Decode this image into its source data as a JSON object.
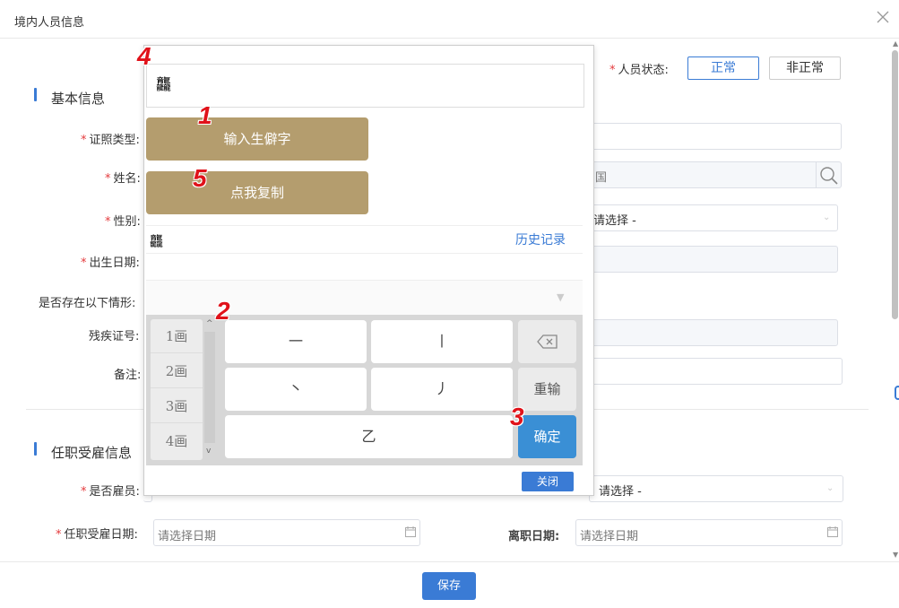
{
  "dialog": {
    "title": "境内人员信息",
    "close_icon": "close-icon"
  },
  "status": {
    "label": "人员状态:",
    "normal": "正常",
    "abnormal": "非正常"
  },
  "basic": {
    "section_title": "基本信息",
    "id_type": "证照类型:",
    "name": "姓名:",
    "gender": "性别:",
    "birth": "出生日期:",
    "situation": "是否存在以下情形:",
    "disability": "残疾证号:",
    "remark": "备注:",
    "country_value": "国",
    "select_placeholder": "请选择 -"
  },
  "employment": {
    "section_title": "任职受雇信息",
    "is_employee": "是否雇员:",
    "hire_date": "任职受雇日期:",
    "hire_date_placeholder": "请选择日期",
    "leave_date": "离职日期:",
    "leave_date_placeholder": "请选择日期",
    "select_placeholder": "请选择 -"
  },
  "save_label": "保存",
  "popup": {
    "input_value": "龘",
    "btn_input_rare": "输入生僻字",
    "btn_copy": "点我复制",
    "candidate": "龘",
    "history_link": "历史记录",
    "strokes": [
      "1画",
      "2画",
      "3画",
      "4画"
    ],
    "keys": {
      "heng": "一",
      "shu": "丨",
      "dian": "丶",
      "pie": "丿",
      "zhe": "乙",
      "reset": "重输",
      "confirm": "确定"
    },
    "close_btn": "关闭",
    "markers": [
      "1",
      "2",
      "3",
      "4",
      "5"
    ]
  },
  "colors": {
    "accent": "#3a7bd5",
    "gold": "#b49d6e",
    "required": "#e4393c",
    "marker": "#e0121a"
  }
}
